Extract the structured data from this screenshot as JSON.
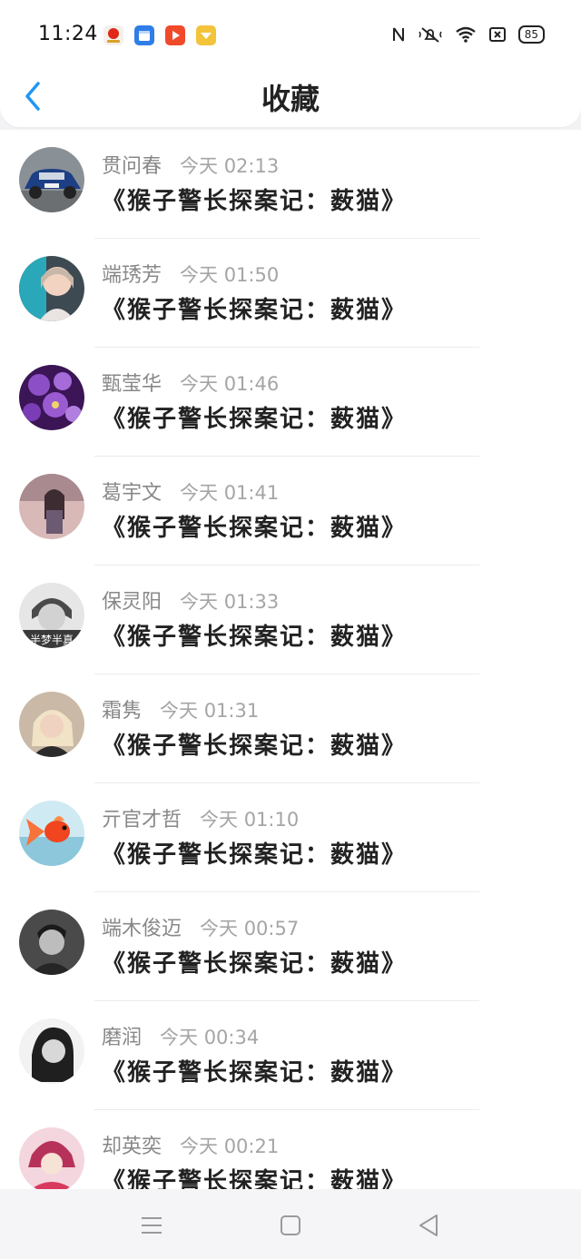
{
  "status_bar": {
    "time": "11:24",
    "battery": "85",
    "app_icons": [
      "news-app-icon",
      "calendar-app-icon",
      "video-app-icon",
      "reward-app-icon"
    ],
    "system_icons": [
      "nfc-icon",
      "mute-icon",
      "wifi-icon",
      "sim-off-icon"
    ]
  },
  "header": {
    "title": "收藏",
    "back_icon": "chevron-left-icon"
  },
  "colors": {
    "accent": "#2196f3",
    "background": "#f3f3f5",
    "name": "#888888",
    "time": "#a5a5a5",
    "text": "#222222"
  },
  "favorites": [
    {
      "user": "贯问春",
      "time": "今天 02:13",
      "work": "《猴子警长探案记：薮猫》",
      "avatar": "car-avatar"
    },
    {
      "user": "端琇芳",
      "time": "今天 01:50",
      "work": "《猴子警长探案记：薮猫》",
      "avatar": "girl-avatar"
    },
    {
      "user": "甄莹华",
      "time": "今天 01:46",
      "work": "《猴子警长探案记：薮猫》",
      "avatar": "flowers-avatar"
    },
    {
      "user": "葛宇文",
      "time": "今天 01:41",
      "work": "《猴子警长探案记：薮猫》",
      "avatar": "illustration-avatar"
    },
    {
      "user": "保灵阳",
      "time": "今天 01:33",
      "work": "《猴子警长探案记：薮猫》",
      "avatar": "bw-portrait-avatar",
      "avatar_text": "半梦半真"
    },
    {
      "user": "霜隽",
      "time": "今天 01:31",
      "work": "《猴子警长探案记：薮猫》",
      "avatar": "blonde-avatar"
    },
    {
      "user": "亓官才哲",
      "time": "今天 01:10",
      "work": "《猴子警长探案记：薮猫》",
      "avatar": "goldfish-avatar"
    },
    {
      "user": "端木俊迈",
      "time": "今天 00:57",
      "work": "《猴子警长探案记：薮猫》",
      "avatar": "man-avatar"
    },
    {
      "user": "磨润",
      "time": "今天 00:34",
      "work": "《猴子警长探案记：薮猫》",
      "avatar": "woman-bw-avatar"
    },
    {
      "user": "却英奕",
      "time": "今天 00:21",
      "work": "《猴子警长探案记：薮猫》",
      "avatar": "anime-avatar"
    }
  ],
  "bottom_nav": {
    "icons": [
      "menu-icon",
      "home-icon",
      "back-triangle-icon"
    ]
  }
}
